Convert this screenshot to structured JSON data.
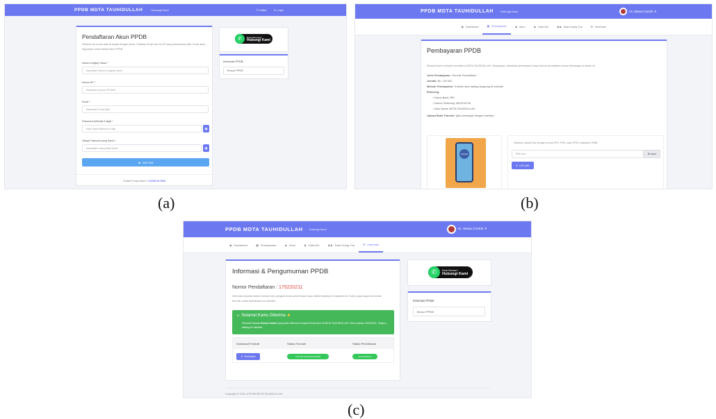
{
  "captions": {
    "a": "(a)",
    "b": "(b)",
    "c": "(c)"
  },
  "colors": {
    "primary": "#6c78f0",
    "success": "#45b85a",
    "whatsapp": "#25d366",
    "danger": "#e0433a"
  },
  "brand": "PPDB MDTA TAUHIDULLAH",
  "nav_contact": "Hubungi Kami",
  "panel_a": {
    "nav_register": "Daftar",
    "nav_login": "Login",
    "card_title": "Pendaftaran Akun PPDB",
    "card_desc": "Silahkan isi semua data di bawah dengan benar. Pastikan Email dan No HP yang dimasukkan aktif. Email akan digunakan untuk aktifasi akun PPDB.",
    "fields": [
      {
        "label": "Nama Lengkap Siswa *",
        "placeholder": "Masukkan Nama Lengkap Kamu"
      },
      {
        "label": "Nomor HP *",
        "placeholder": "Masukkan Nomor HP Aktif"
      },
      {
        "label": "Email *",
        "placeholder": "Masukkan Email Aktif"
      },
      {
        "label": "Password (Minimal 6 digit) *",
        "placeholder": "Kata Sandi Minimal 6 Digit"
      },
      {
        "label": "Ulangi Password yang Sama *",
        "placeholder": "Masukkan Ulang Kata Sandi"
      }
    ],
    "submit": "DAFTAR",
    "footer_text": "Sudah Punya Akun?",
    "footer_link": "LOGIN DI SINI",
    "wa_small": "Butuh Bantuan?",
    "wa_big": "Hubungi Kami",
    "info_title": "Informasi PPDB:",
    "info_input": "Brosur PPDB"
  },
  "panel_b": {
    "user": "Hi, Siswa Contoh",
    "tabs": [
      "Dashboard",
      "Pembayaran",
      "Akun",
      "Data Diri",
      "Data Orang Tua",
      "Informasi"
    ],
    "active_tab": 1,
    "card_title": "Pembayaran PPDB",
    "intro": "Selamat Kamu berhasil mendaftar di MDTA TAUHIDULLAH. Selanjutnya, selesaikan pembayaran biaya formulir pendaftaran sesuai keterangan di bawah ini.",
    "rows": [
      {
        "k": "Jenis Pembayaran:",
        "v": "Formulir Pendaftaran"
      },
      {
        "k": "Jumlah:",
        "v": "Rp. 100.000"
      },
      {
        "k": "Metode Pembayaran:",
        "v": "Transfer atau datang langsung ke sekolah"
      },
      {
        "k": "Rekening:",
        "v": ""
      }
    ],
    "bank": [
      "Nama Bank: BRI",
      "Nomor Rekening: 0843745745",
      "Atas Nama: MDTA TAUHIDULLAH"
    ],
    "upload_label": "Upload Bukti Transfer:",
    "upload_note": "(jika membayar dengan transfer)",
    "upload_help": "Silahkan upload foto dengan format JPG, PNG, atau JPEG maksimal 10MB.",
    "file_placeholder": "Pilih foto",
    "browse": "Browse",
    "upload_btn": "UPLOAD",
    "phone_label": "Upload"
  },
  "panel_c": {
    "user": "Hi, Siswa Contoh",
    "tabs": [
      "Dashboard",
      "Pembayaran",
      "Akun",
      "Data Diri",
      "Data Orang Tua",
      "Informasi"
    ],
    "active_tab": 5,
    "card_title": "Informasi & Pengumuman PPDB",
    "reg_label": "Nomor Pendaftaran :",
    "reg_number": "175220211",
    "desc": "Informasi seputar status formulir dan pengumuman penerimaan akan diinformasikan di halaman ini. Kamu juga dapat mencetak formulir untuk diserahkan ke sekolah.",
    "alert_title": "Selamat Kamu Diterima",
    "alert_text_1": "Selamat kepada",
    "alert_name": "Siswa Contoh",
    "alert_text_2": "yang telah diterima menjadi Murid baru di MDTA TAUHIDULLAH Tahun Ajaran 2020/2021. Segera datang ke sekolah.",
    "table_headers": [
      "Download Formulir",
      "Status Formulir",
      "Status Penerimaan"
    ],
    "download_btn": "Download",
    "status_form": "Formulir Sudah Diverifikasi",
    "status_accept": "Anda Diterima",
    "wa_small": "Butuh Bantuan?",
    "wa_big": "Hubungi Kami",
    "info_title": "Informasi PPDB:",
    "info_input": "Brosur PPDB",
    "copyright": "Copyright © 2021 ♦ PPDB MDTA TAUHIDULLAH"
  }
}
